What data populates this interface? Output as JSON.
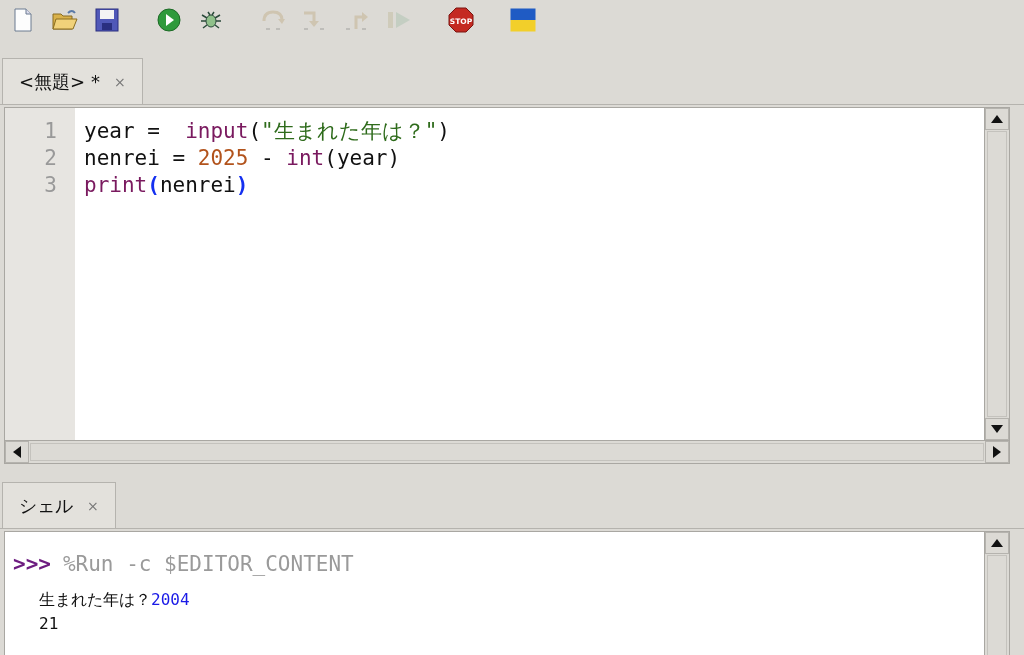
{
  "toolbar": [
    {
      "kind": "new",
      "disabled": false
    },
    {
      "kind": "open",
      "disabled": false
    },
    {
      "kind": "save",
      "disabled": false
    },
    {
      "kind": "gap"
    },
    {
      "kind": "run",
      "disabled": false
    },
    {
      "kind": "debug",
      "disabled": false
    },
    {
      "kind": "gap"
    },
    {
      "kind": "step-over",
      "disabled": true
    },
    {
      "kind": "step-into",
      "disabled": true
    },
    {
      "kind": "step-out",
      "disabled": true
    },
    {
      "kind": "resume",
      "disabled": true
    },
    {
      "kind": "gap"
    },
    {
      "kind": "stop",
      "disabled": false,
      "label": "STOP"
    },
    {
      "kind": "gap"
    },
    {
      "kind": "flag",
      "disabled": false
    }
  ],
  "editor": {
    "tabs": [
      {
        "label": "<無題> *",
        "close": "×",
        "selected": true
      }
    ],
    "lines": [
      {
        "number": "1",
        "tokens": [
          {
            "kind": "name",
            "text": "year =  "
          },
          {
            "kind": "builtin",
            "text": "input"
          },
          {
            "kind": "name",
            "text": "("
          },
          {
            "kind": "string",
            "text": "\"生まれた年は？\""
          },
          {
            "kind": "name",
            "text": ")"
          }
        ]
      },
      {
        "number": "2",
        "tokens": [
          {
            "kind": "name",
            "text": "nenrei = "
          },
          {
            "kind": "number",
            "text": "2025"
          },
          {
            "kind": "name",
            "text": " - "
          },
          {
            "kind": "builtin",
            "text": "int"
          },
          {
            "kind": "name",
            "text": "(year)"
          }
        ]
      },
      {
        "number": "3",
        "tokens": [
          {
            "kind": "builtin",
            "text": "print"
          },
          {
            "kind": "bracket",
            "text": "("
          },
          {
            "kind": "name",
            "text": "nenrei"
          },
          {
            "kind": "bracket",
            "text": ")"
          }
        ]
      }
    ]
  },
  "shell": {
    "tabs": [
      {
        "label": "シェル",
        "close": "×",
        "selected": true
      }
    ],
    "lines": [
      {
        "kind": "command",
        "prompt": ">>>",
        "text": "%Run -c $EDITOR_CONTENT"
      },
      {
        "kind": "output",
        "text": "生まれた年は？",
        "input": "2004"
      },
      {
        "kind": "output",
        "text": "21"
      }
    ]
  }
}
